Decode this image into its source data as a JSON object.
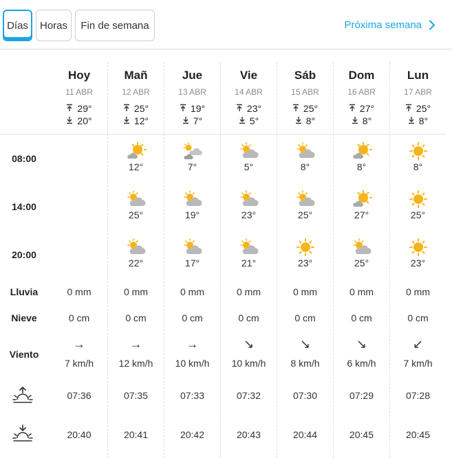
{
  "tabs": [
    {
      "label": "Días",
      "active": true
    },
    {
      "label": "Horas",
      "active": false
    },
    {
      "label": "Fin de semana",
      "active": false
    }
  ],
  "next_link": "Próxima semana",
  "row_labels": {
    "t1": "08:00",
    "t2": "14:00",
    "t3": "20:00",
    "rain": "Lluvia",
    "snow": "Nieve",
    "wind": "Viento"
  },
  "sun_icons": {
    "sunrise": "sunrise-icon",
    "sunset": "sunset-icon"
  },
  "colors": {
    "accent": "#1aa6e6",
    "sun": "#f7b51b",
    "cloud": "#b9b9b9"
  },
  "days": [
    {
      "name": "Hoy",
      "date": "11 ABR",
      "max": "29°",
      "min": "20°",
      "slots": [
        null,
        null,
        null
      ],
      "rain": "0 mm",
      "snow": "0 cm",
      "wind_dir": "→",
      "wind": "7 km/h",
      "sunrise": "07:36",
      "sunset": "20:40"
    },
    {
      "name": "Mañ",
      "date": "12 ABR",
      "max": "25°",
      "min": "12°",
      "slots": [
        {
          "icon": "sun-small-cloud",
          "temp": "12°"
        },
        {
          "icon": "cloud-sun",
          "temp": "25°"
        },
        {
          "icon": "cloud-sun",
          "temp": "22°"
        }
      ],
      "rain": "0 mm",
      "snow": "0 cm",
      "wind_dir": "→",
      "wind": "12 km/h",
      "sunrise": "07:35",
      "sunset": "20:41"
    },
    {
      "name": "Jue",
      "date": "13 ABR",
      "max": "19°",
      "min": "7°",
      "slots": [
        {
          "icon": "clouds-sun",
          "temp": "7°"
        },
        {
          "icon": "cloud-sun",
          "temp": "19°"
        },
        {
          "icon": "cloud-sun",
          "temp": "17°"
        }
      ],
      "rain": "0 mm",
      "snow": "0 cm",
      "wind_dir": "→",
      "wind": "10 km/h",
      "sunrise": "07:33",
      "sunset": "20:42"
    },
    {
      "name": "Vie",
      "date": "14 ABR",
      "max": "23°",
      "min": "5°",
      "slots": [
        {
          "icon": "cloud-sun",
          "temp": "5°"
        },
        {
          "icon": "cloud-sun",
          "temp": "23°"
        },
        {
          "icon": "cloud-sun",
          "temp": "21°"
        }
      ],
      "rain": "0 mm",
      "snow": "0 cm",
      "wind_dir": "↘",
      "wind": "10 km/h",
      "sunrise": "07:32",
      "sunset": "20:43"
    },
    {
      "name": "Sáb",
      "date": "15 ABR",
      "max": "25°",
      "min": "8°",
      "slots": [
        {
          "icon": "cloud-sun",
          "temp": "8°"
        },
        {
          "icon": "cloud-sun",
          "temp": "25°"
        },
        {
          "icon": "sun",
          "temp": "23°"
        }
      ],
      "rain": "0 mm",
      "snow": "0 cm",
      "wind_dir": "↘",
      "wind": "8 km/h",
      "sunrise": "07:30",
      "sunset": "20:44"
    },
    {
      "name": "Dom",
      "date": "16 ABR",
      "max": "27°",
      "min": "8°",
      "slots": [
        {
          "icon": "sun-small-cloud",
          "temp": "8°"
        },
        {
          "icon": "sun-small-cloud",
          "temp": "27°"
        },
        {
          "icon": "cloud-sun",
          "temp": "25°"
        }
      ],
      "rain": "0 mm",
      "snow": "0 cm",
      "wind_dir": "↘",
      "wind": "6 km/h",
      "sunrise": "07:29",
      "sunset": "20:45"
    },
    {
      "name": "Lun",
      "date": "17 ABR",
      "max": "25°",
      "min": "8°",
      "slots": [
        {
          "icon": "sun",
          "temp": "8°"
        },
        {
          "icon": "sun",
          "temp": "25°"
        },
        {
          "icon": "sun",
          "temp": "23°"
        }
      ],
      "rain": "0 mm",
      "snow": "0 cm",
      "wind_dir": "↙",
      "wind": "7 km/h",
      "sunrise": "07:28",
      "sunset": "20:45"
    }
  ]
}
